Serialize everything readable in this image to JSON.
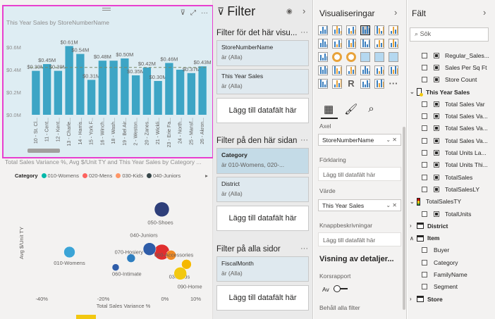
{
  "report": {
    "chart1": {
      "title": "This Year Sales by StoreNumberName",
      "header_icons": [
        "filter-icon",
        "focus-mode-icon",
        "more-options-icon"
      ]
    },
    "chart2": {
      "title": "Total Sales Variance %, Avg $/Unit TY and This Year Sales by Category ...",
      "legend_title": "Category",
      "legend": [
        {
          "label": "010-Womens",
          "color": "#01b8aa"
        },
        {
          "label": "020-Mens",
          "color": "#fd625e"
        },
        {
          "label": "030-Kids",
          "color": "#fe9666"
        },
        {
          "label": "040-Juniors",
          "color": "#374649"
        }
      ]
    }
  },
  "chart_data": [
    {
      "type": "bar",
      "title": "This Year Sales by StoreNumberName",
      "categories": [
        "10 - St. Cl...",
        "11 - Cent...",
        "12 - Kent...",
        "13 - Charle...",
        "14 - Harris...",
        "15 - York F...",
        "16 - Winch...",
        "18 - Wash...",
        "19 - Bel Air...",
        "2 - Weston...",
        "20 - Zanes...",
        "21 - Wickli...",
        "23 - Erie Fa...",
        "24 - North...",
        "25 - Mansf...",
        "26 - Akron..."
      ],
      "values": [
        0.39,
        0.45,
        0.39,
        0.61,
        0.54,
        0.31,
        0.48,
        0.48,
        0.5,
        0.35,
        0.42,
        0.3,
        0.46,
        0.4,
        0.37,
        0.43
      ],
      "labels": [
        "$0.39M",
        "$0.45M",
        "$0.39M",
        "$0.61M",
        "$0.54M",
        "$0.31M",
        "$0.48M",
        "$0.48M",
        "$0.50M",
        "$0.35M",
        "$0.42M",
        "$0.30M",
        "$0.46M",
        "$0.40M",
        "$0.37M",
        "$0.43M"
      ],
      "label_shown": [
        true,
        true,
        true,
        true,
        true,
        true,
        true,
        false,
        true,
        true,
        true,
        true,
        true,
        false,
        true,
        true
      ],
      "y_ticks": [
        "$0.0M",
        "$0.2M",
        "$0.4M",
        "$0.6M"
      ],
      "ylim": [
        0,
        0.7
      ],
      "reference_line": 0.42,
      "bar_color": "#3da5c5"
    },
    {
      "type": "scatter",
      "title": "Total Sales Variance %, Avg $/Unit TY and This Year Sales by Category ...",
      "xlabel": "Total Sales Variance %",
      "ylabel": "Avg $/Unit TY",
      "x_ticks": [
        "-40%",
        "-20%",
        "0%",
        "10%"
      ],
      "points": [
        {
          "label": "010-Womens",
          "x": -31,
          "y": 2.2,
          "size": 14,
          "color": "#3ba4d6"
        },
        {
          "label": "020-Mens",
          "x": -1,
          "y": 2.2,
          "size": 20,
          "color": "#e02f2f"
        },
        {
          "label": "030-Kids",
          "x": 7,
          "y": 1.8,
          "size": 12,
          "color": "#f5b800"
        },
        {
          "label": "040-Juniors",
          "x": -5,
          "y": 2.3,
          "size": 16,
          "color": "#2e5ca8"
        },
        {
          "label": "050-Shoes",
          "x": -1,
          "y": 3.6,
          "size": 19,
          "color": "#2e3f7a"
        },
        {
          "label": "060-Intimate",
          "x": -16,
          "y": 1.7,
          "size": 8,
          "color": "#2e5ca8"
        },
        {
          "label": "070-Hosiery",
          "x": -11,
          "y": 2.0,
          "size": 10,
          "color": "#2e7ebf"
        },
        {
          "label": "080-Accessories",
          "x": 2,
          "y": 2.1,
          "size": 12,
          "color": "#f08a24"
        },
        {
          "label": "090-Home",
          "x": 5,
          "y": 1.5,
          "size": 16,
          "color": "#f2c811"
        }
      ]
    }
  ],
  "filter_pane": {
    "title": "Filter",
    "visual_section": "Filter för det här visu...",
    "visual_filters": [
      {
        "name": "StoreNumberName",
        "value": "är (Alla)"
      },
      {
        "name": "This Year Sales",
        "value": "är (Alla)"
      }
    ],
    "add_field": "Lägg till datafält här",
    "page_section": "Filter på den här sidan",
    "page_filters": [
      {
        "name": "Category",
        "value": "är 010-Womens, 020-..."
      },
      {
        "name": "District",
        "value": "är (Alla)"
      }
    ],
    "all_pages_section": "Filter på alla sidor",
    "all_filters": [
      {
        "name": "FiscalMonth",
        "value": "är (Alla)"
      }
    ]
  },
  "viz_pane": {
    "title": "Visualiseringar",
    "axis_label": "Axel",
    "axis_field": "StoreNumberName",
    "legend_label": "Förklaring",
    "add_field": "Lägg till datafält här",
    "value_label": "Värde",
    "value_field": "This Year Sales",
    "tooltips_label": "Knappbeskrivningar",
    "drillthrough_title": "Visning av detaljer...",
    "cross_report": "Korsrapport",
    "off_label": "Av",
    "keep_filters": "Behåll alla filter"
  },
  "fields_pane": {
    "title": "Fält",
    "search_placeholder": "Sök",
    "items": [
      {
        "kind": "field",
        "label": "Regular_Sales..."
      },
      {
        "kind": "field",
        "label": "Sales Per Sq Ft"
      },
      {
        "kind": "field",
        "label": "Store Count"
      },
      {
        "kind": "table",
        "label": "This Year Sales",
        "icon": "measure"
      },
      {
        "kind": "field",
        "label": "Total Sales Var"
      },
      {
        "kind": "field",
        "label": "Total Sales Va..."
      },
      {
        "kind": "field",
        "label": "Total Sales Va..."
      },
      {
        "kind": "field",
        "label": "Total Sales Va..."
      },
      {
        "kind": "field",
        "label": "Total Units La..."
      },
      {
        "kind": "field",
        "label": "Total Units Thi..."
      },
      {
        "kind": "field",
        "label": "TotalSales"
      },
      {
        "kind": "field",
        "label": "TotalSalesLY"
      },
      {
        "kind": "table",
        "label": "TotalSalesTY",
        "icon": "kpi"
      },
      {
        "kind": "field",
        "label": "TotalUnits"
      },
      {
        "kind": "table",
        "label": "District",
        "icon": "table"
      },
      {
        "kind": "table",
        "label": "Item",
        "icon": "table",
        "expanded": true
      },
      {
        "kind": "field-plain",
        "label": "Buyer"
      },
      {
        "kind": "field-plain",
        "label": "Category"
      },
      {
        "kind": "field-plain",
        "label": "FamilyName"
      },
      {
        "kind": "field-plain",
        "label": "Segment"
      },
      {
        "kind": "table",
        "label": "Store",
        "icon": "table"
      }
    ]
  }
}
